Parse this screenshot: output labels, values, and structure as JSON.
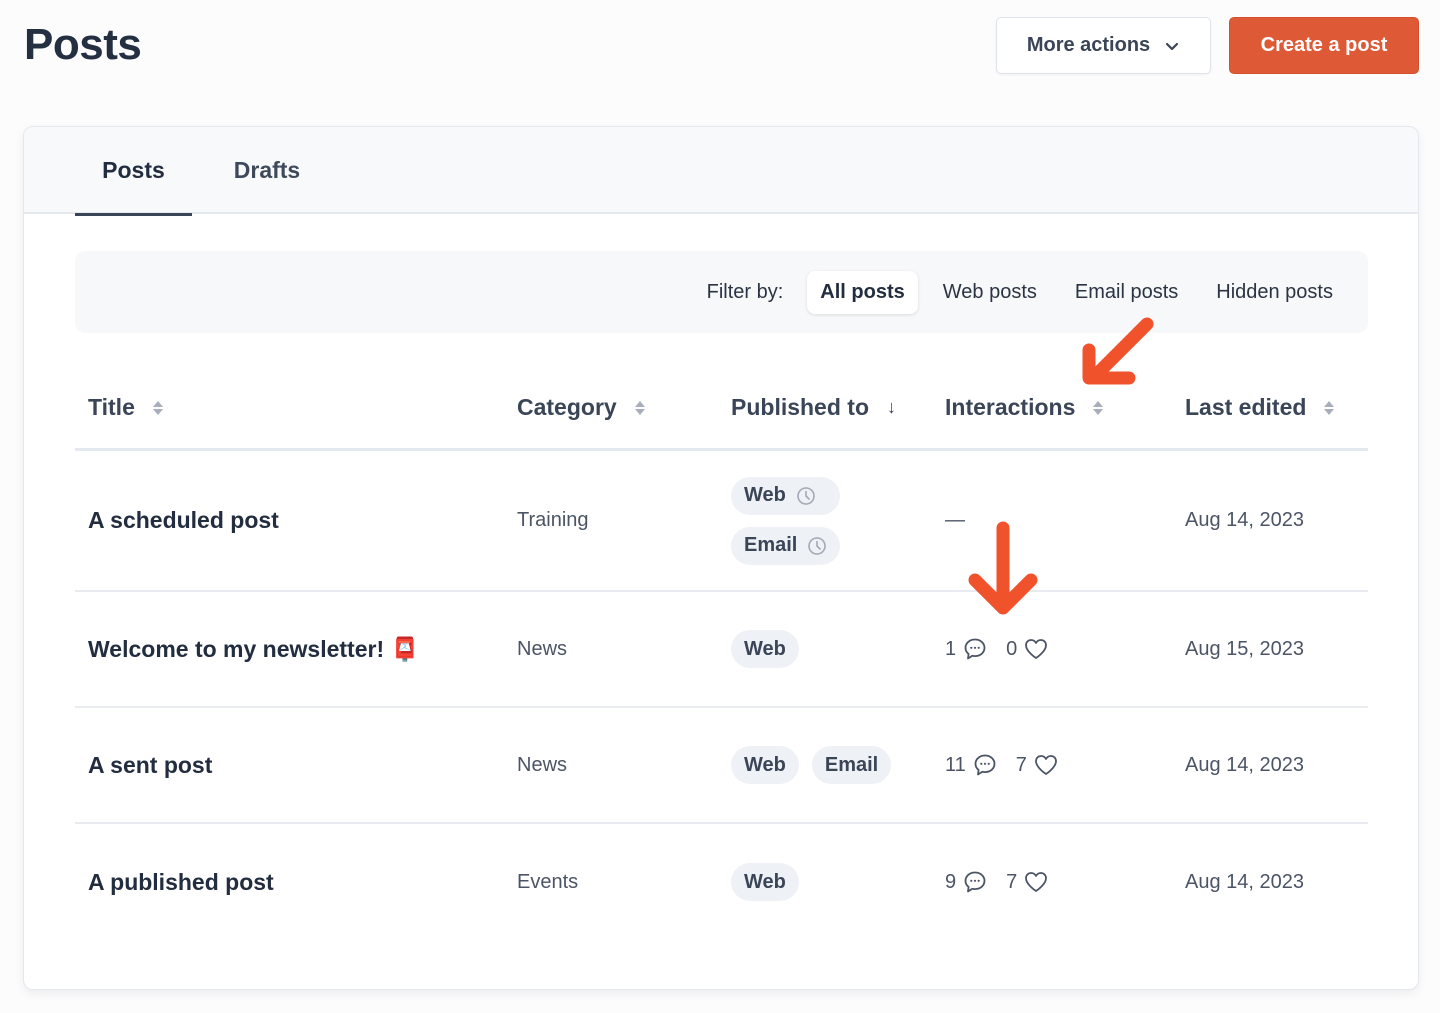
{
  "page": {
    "title": "Posts"
  },
  "header": {
    "more_actions_label": "More actions",
    "create_label": "Create a post",
    "accent_color": "#de5935"
  },
  "tabs": [
    {
      "label": "Posts",
      "active": true
    },
    {
      "label": "Drafts",
      "active": false
    }
  ],
  "filter": {
    "label": "Filter by:",
    "options": [
      {
        "label": "All posts",
        "active": true
      },
      {
        "label": "Web posts",
        "active": false
      },
      {
        "label": "Email posts",
        "active": false
      },
      {
        "label": "Hidden posts",
        "active": false
      }
    ]
  },
  "table": {
    "columns": [
      {
        "label": "Title",
        "sort": "sortable"
      },
      {
        "label": "Category",
        "sort": "sortable"
      },
      {
        "label": "Published to",
        "sort": "descending"
      },
      {
        "label": "Interactions",
        "sort": "sortable"
      },
      {
        "label": "Last edited",
        "sort": "sortable"
      }
    ],
    "rows": [
      {
        "title": "A scheduled post",
        "category": "Training",
        "published_to": [
          {
            "label": "Web",
            "scheduled": true
          },
          {
            "label": "Email",
            "scheduled": true
          }
        ],
        "interactions": null,
        "interactions_empty": "—",
        "last_edited": "Aug 14, 2023"
      },
      {
        "title": "Welcome to my newsletter! 📮",
        "category": "News",
        "published_to": [
          {
            "label": "Web",
            "scheduled": false
          }
        ],
        "interactions": {
          "comments": "1",
          "likes": "0"
        },
        "last_edited": "Aug 15, 2023"
      },
      {
        "title": "A sent post",
        "category": "News",
        "published_to": [
          {
            "label": "Web",
            "scheduled": false
          },
          {
            "label": "Email",
            "scheduled": false
          }
        ],
        "interactions": {
          "comments": "11",
          "likes": "7"
        },
        "last_edited": "Aug 14, 2023"
      },
      {
        "title": "A published post",
        "category": "Events",
        "published_to": [
          {
            "label": "Web",
            "scheduled": false
          }
        ],
        "interactions": {
          "comments": "9",
          "likes": "7"
        },
        "last_edited": "Aug 14, 2023"
      }
    ]
  },
  "annotations": {
    "arrow_color": "#f0532b"
  }
}
